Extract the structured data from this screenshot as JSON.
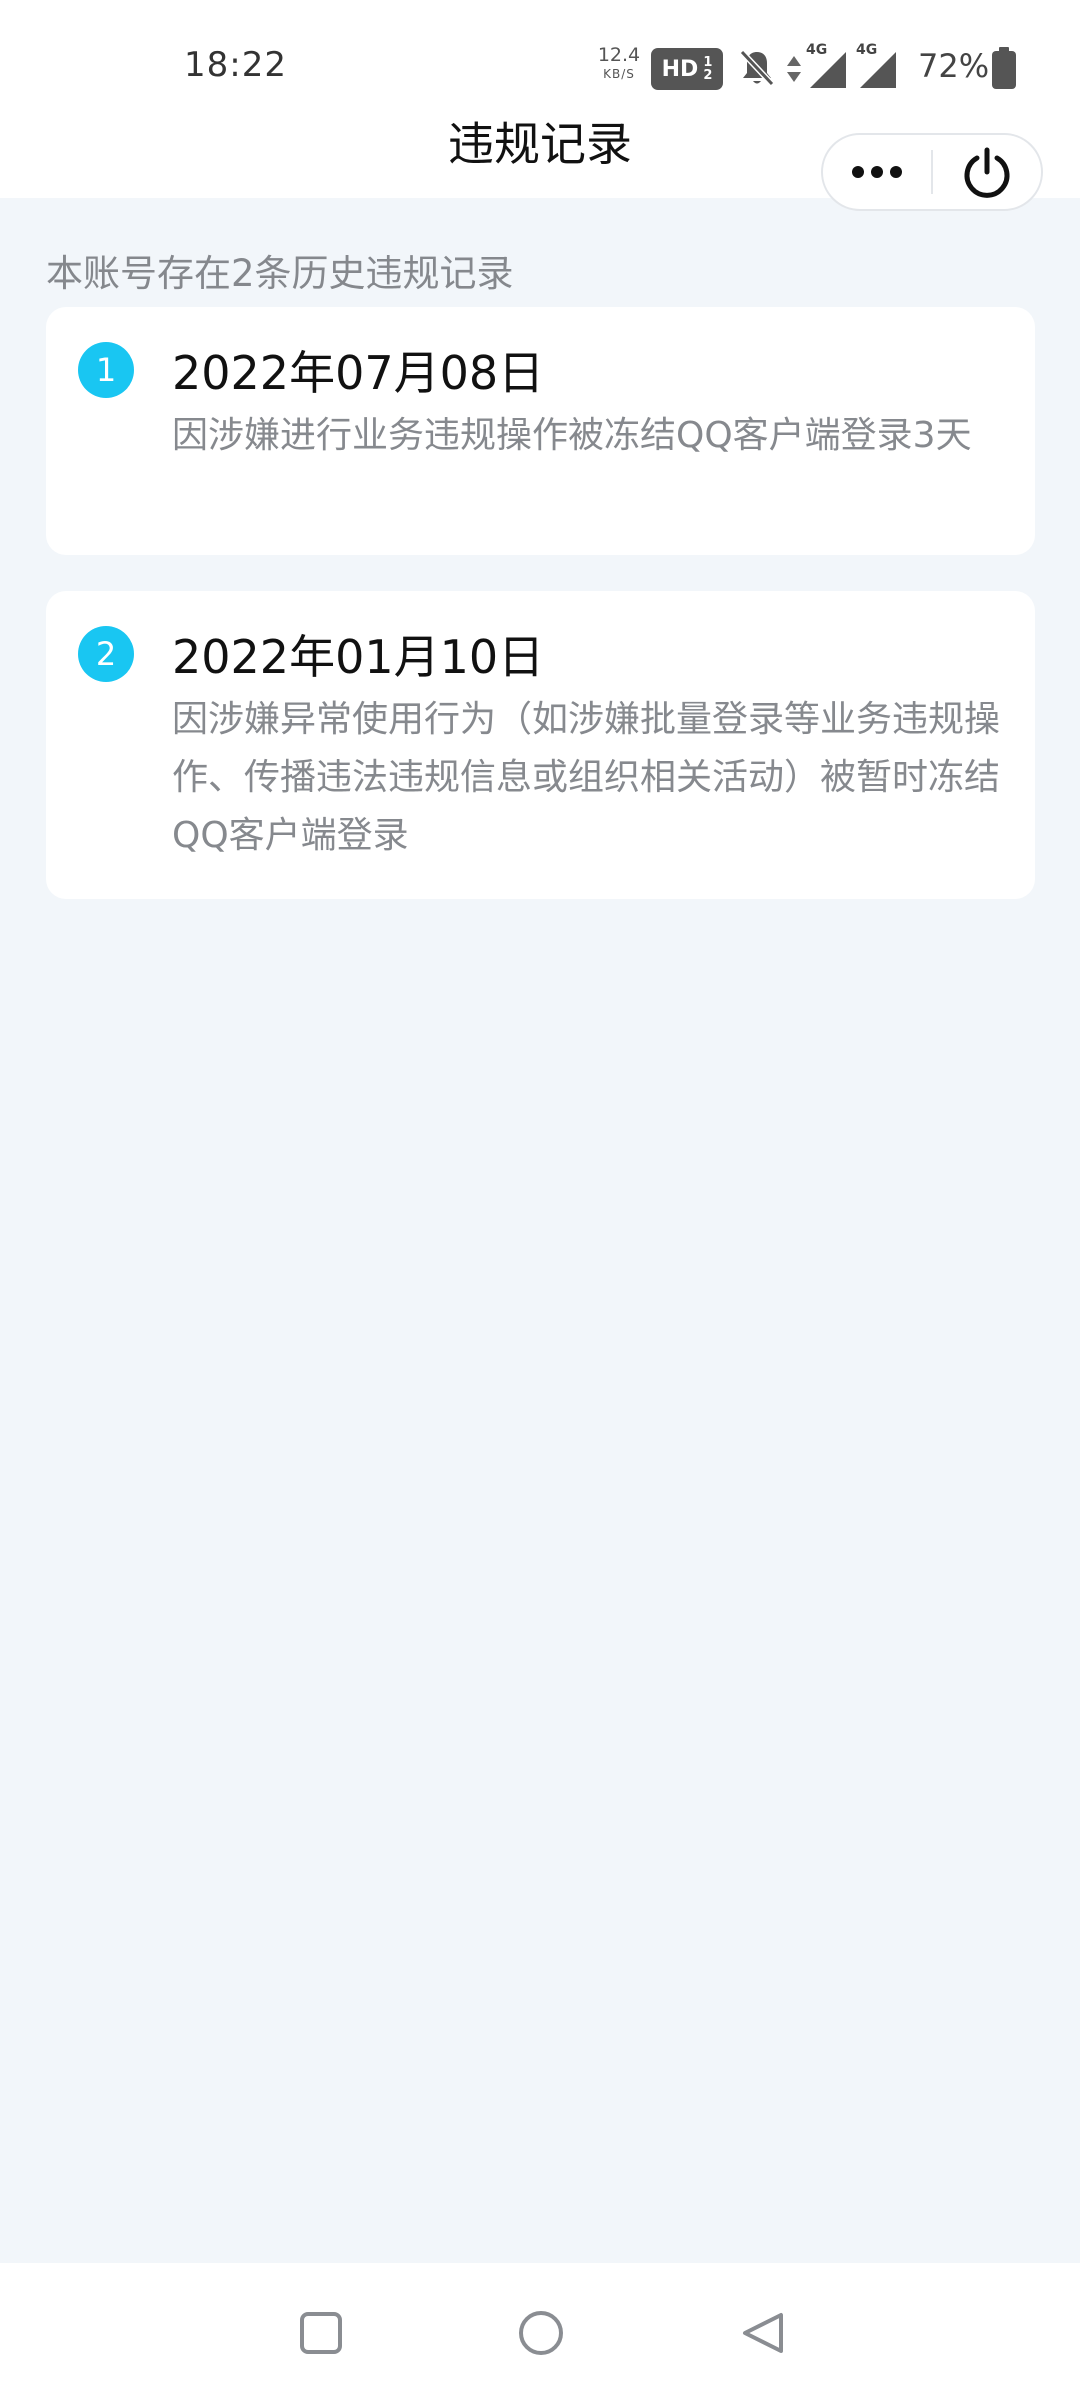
{
  "status_bar": {
    "time": "18:22",
    "net_speed_value": "12.4",
    "net_speed_unit": "KB/S",
    "hd_label": "HD",
    "hd_sub_top": "1",
    "hd_sub_bottom": "2",
    "signal_1_label": "4G",
    "signal_2_label": "4G",
    "battery_percent": "72%",
    "icons": [
      "hd-icon",
      "bell-muted-icon",
      "data-arrows-icon",
      "signal-4g-icon",
      "signal-4g-icon",
      "battery-icon"
    ]
  },
  "header": {
    "title": "违规记录",
    "capsule": {
      "more_icon": "more-dots-icon",
      "close_icon": "power-icon"
    }
  },
  "main": {
    "summary": "本账号存在2条历史违规记录",
    "records": [
      {
        "index": "1",
        "date": "2022年07月08日",
        "description": "因涉嫌进行业务违规操作被冻结QQ客户端登录3天"
      },
      {
        "index": "2",
        "date": "2022年01月10日",
        "description": "因涉嫌异常使用行为（如涉嫌批量登录等业务违规操作、传播违法违规信息或组织相关活动）被暂时冻结QQ客户端登录"
      }
    ]
  },
  "nav_bar": {
    "icons": [
      "recents-square-icon",
      "home-circle-icon",
      "back-triangle-icon"
    ]
  },
  "colors": {
    "background": "#f2f6fa",
    "card": "#ffffff",
    "accent": "#19c6f2",
    "secondary_text": "#86898e",
    "primary_text": "#111111"
  }
}
